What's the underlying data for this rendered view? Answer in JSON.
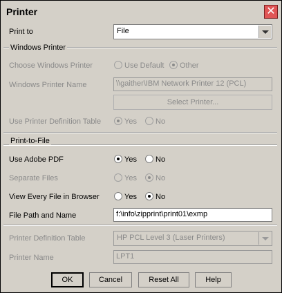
{
  "window": {
    "title": "Printer",
    "close_glyph": "✕"
  },
  "print_to": {
    "label": "Print to",
    "value": "File"
  },
  "windows_printer": {
    "section_title": "Windows Printer",
    "choose_label": "Choose Windows Printer",
    "opt_default": "Use Default",
    "opt_other": "Other",
    "name_label": "Windows Printer Name",
    "name_value": "\\\\gaither\\IBM Network Printer 12 (PCL)",
    "select_button": "Select Printer...",
    "def_table_label": "Use Printer Definition Table",
    "opt_yes": "Yes",
    "opt_no": "No"
  },
  "print_to_file": {
    "section_title": "Print-to-File",
    "pdf_label": "Use Adobe PDF",
    "separate_label": "Separate Files",
    "view_label": "View Every File in Browser",
    "path_label": "File Path and Name",
    "path_value": "f:\\info\\zipprint\\print01\\exmp",
    "opt_yes": "Yes",
    "opt_no": "No"
  },
  "printer_def": {
    "table_label": "Printer Definition Table",
    "table_value": "HP PCL Level 3 (Laser Printers)",
    "name_label": "Printer Name",
    "name_value": "LPT1"
  },
  "buttons": {
    "ok": "OK",
    "cancel": "Cancel",
    "reset": "Reset All",
    "help": "Help"
  }
}
